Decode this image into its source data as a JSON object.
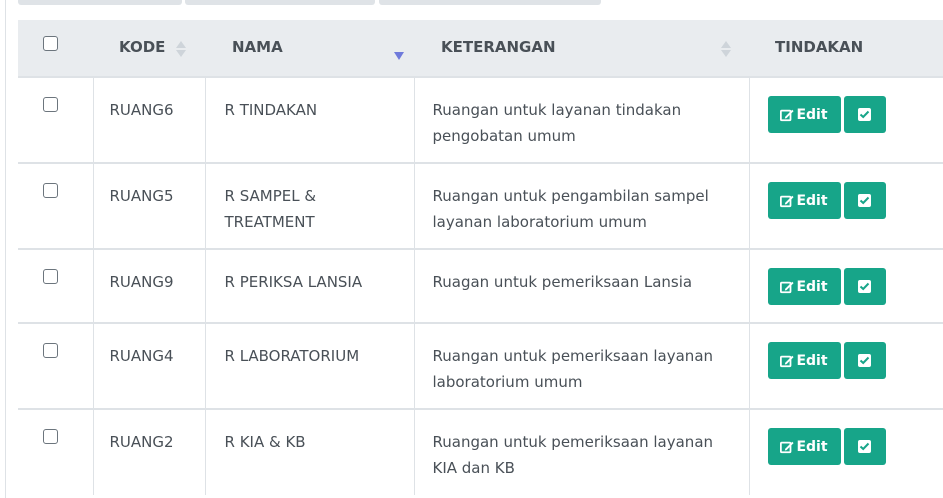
{
  "table": {
    "headers": {
      "kode": "KODE",
      "nama": "NAMA",
      "keterangan": "KETERANGAN",
      "tindakan": "TINDAKAN"
    },
    "sort": {
      "active_column": "nama",
      "direction": "desc"
    },
    "rows": [
      {
        "kode": "RUANG6",
        "nama": "R TINDAKAN",
        "keterangan": "Ruangan untuk layanan tindakan pengobatan umum",
        "edit_label": "Edit",
        "checked": false
      },
      {
        "kode": "RUANG5",
        "nama": "R SAMPEL & TREATMENT",
        "keterangan": "Ruangan untuk pengambilan sampel layanan laboratorium umum",
        "edit_label": "Edit",
        "checked": false
      },
      {
        "kode": "RUANG9",
        "nama": "R PERIKSA LANSIA",
        "keterangan": "Ruagan untuk pemeriksaan Lansia",
        "edit_label": "Edit",
        "checked": false
      },
      {
        "kode": "RUANG4",
        "nama": "R LABORATORIUM",
        "keterangan": "Ruangan untuk pemeriksaan layanan laboratorium umum",
        "edit_label": "Edit",
        "checked": false
      },
      {
        "kode": "RUANG2",
        "nama": "R KIA & KB",
        "keterangan": "Ruangan untuk pemeriksaan layanan KIA dan KB",
        "edit_label": "Edit",
        "checked": false
      }
    ]
  },
  "colors": {
    "header_bg": "#e9ecef",
    "accent": "#17a589",
    "sort_active": "#6f7adb",
    "border": "#dee2e6",
    "text": "#495057"
  },
  "icons": {
    "edit": "pencil-square-icon",
    "select": "check-square-icon",
    "sort_idle": "sort-icon",
    "sort_active": "sort-down-icon"
  }
}
